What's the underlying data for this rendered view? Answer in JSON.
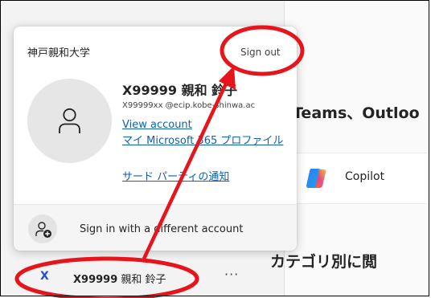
{
  "background": {
    "apps_heading": "Teams、Outloo",
    "copilot_label": "Copilot",
    "category_heading": "カテゴリ別に閲"
  },
  "account_card": {
    "org_name": "神戸親和大学",
    "sign_out_label": "Sign out",
    "user_name": "X99999 親和 鈴子",
    "email": "X99999xx @ecip.kobe-shinwa.ac",
    "view_account_label": "View account",
    "profile_link_label": "マイ Microsoft 365 プロファイル",
    "third_party_link_label": "サード パーティの通知",
    "add_account_label": "Sign in with a different account"
  },
  "account_row": {
    "initial": "X",
    "name_id": "X99999",
    "name_rest": "親和 鈴子",
    "more_label": "···"
  },
  "colors": {
    "link": "#0f5fb5",
    "annotation_red": "#e8141b",
    "initial_blue": "#1f4fd1"
  },
  "icons": {
    "avatar": "person-icon",
    "add_account": "person-add-icon",
    "copilot": "copilot-logo-icon"
  }
}
